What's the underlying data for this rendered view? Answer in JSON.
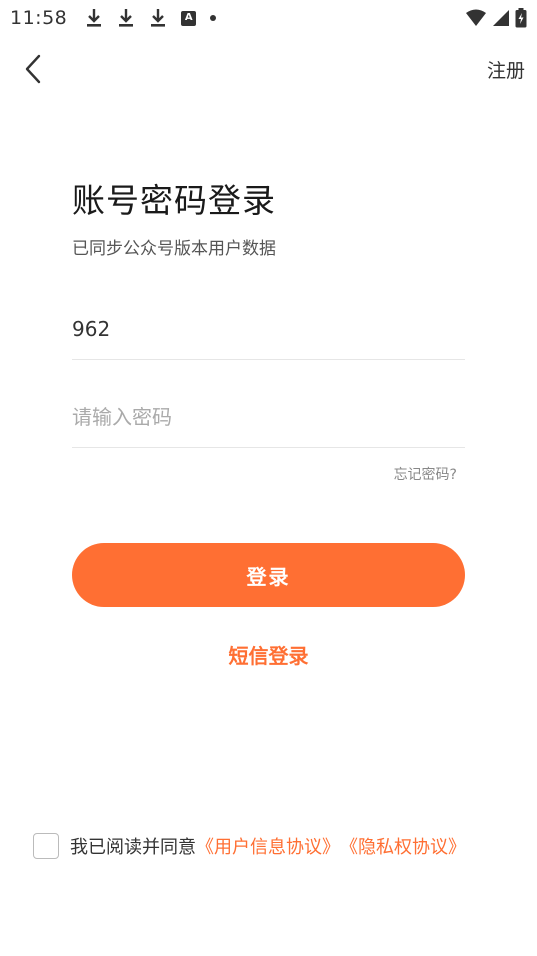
{
  "status_bar": {
    "time": "11:58",
    "left_icons": [
      "download-icon",
      "download-icon",
      "download-icon",
      "a-box-icon",
      "dot-icon"
    ],
    "a_icon_text": "A",
    "right_icons": [
      "wifi-icon",
      "cell-signal-icon",
      "battery-charging-icon"
    ]
  },
  "nav": {
    "back_icon": "chevron-left-icon",
    "register_label": "注册"
  },
  "title": "账号密码登录",
  "subtitle": "已同步公众号版本用户数据",
  "form": {
    "account_value": "962",
    "password_placeholder": "请输入密码",
    "forgot_label": "忘记密码?"
  },
  "login_button_label": "登录",
  "sms_login_label": "短信登录",
  "agreement": {
    "prefix": "我已阅读并同意",
    "user_agreement": "《用户信息协议》",
    "privacy_agreement": "《隐私权协议》",
    "checked": false
  },
  "colors": {
    "accent": "#ff6f33",
    "text_primary": "#1a1a1a",
    "text_secondary": "#555555",
    "placeholder": "#aaaaaa",
    "divider": "#e6e6e6"
  }
}
